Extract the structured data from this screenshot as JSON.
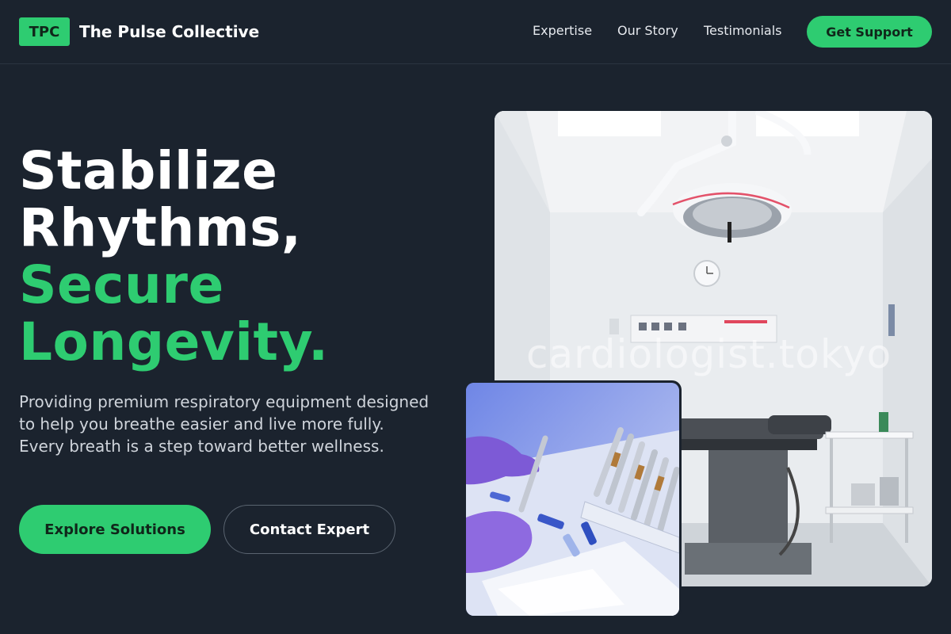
{
  "header": {
    "brand_badge": "TPC",
    "brand_name": "The Pulse Collective",
    "nav": [
      "Expertise",
      "Our Story",
      "Testimonials"
    ],
    "cta": "Get Support"
  },
  "hero": {
    "title_lines": [
      "Stabilize",
      "Rhythms,"
    ],
    "title_accent_lines": [
      "Secure",
      "Longevity."
    ],
    "description": "Providing premium respiratory equipment designed to help you breathe easier and live more fully. Every breath is a step toward better wellness.",
    "primary_button": "Explore Solutions",
    "secondary_button": "Contact Expert"
  },
  "images": {
    "main_watermark": "cardiologist.tokyo"
  },
  "colors": {
    "background": "#1b232e",
    "accent": "#2ecc71",
    "text": "#ffffff",
    "muted_text": "#cfd4db"
  }
}
